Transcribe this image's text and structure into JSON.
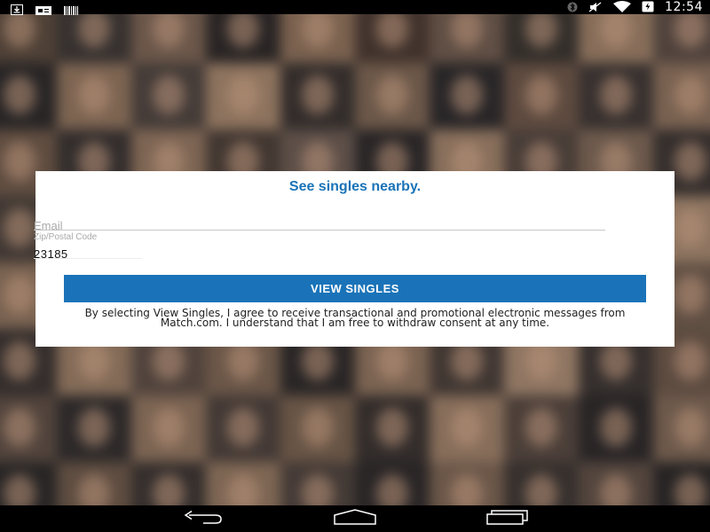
{
  "status_bar": {
    "time": "12:54",
    "left_icons": [
      "download-icon",
      "notification-card-icon",
      "barcode-icon"
    ],
    "right_icons": [
      "bluetooth-icon",
      "mute-icon",
      "wifi-icon",
      "battery-charging-icon"
    ]
  },
  "card": {
    "title": "See singles nearby.",
    "email": {
      "placeholder": "Email",
      "value": ""
    },
    "zip": {
      "label": "Zip/Postal Code",
      "value": "23185"
    },
    "submit_label": "VIEW SINGLES",
    "disclaimer": "By selecting View Singles, I agree to receive transactional and promotional electronic messages from Match.com. I understand that I am free to withdraw consent at any time."
  },
  "nav_bar": {
    "icons": [
      "back-icon",
      "home-icon",
      "recent-apps-icon"
    ]
  },
  "colors": {
    "accent": "#1a73b8",
    "card_bg": "#ffffff",
    "bar_bg": "#000000"
  }
}
